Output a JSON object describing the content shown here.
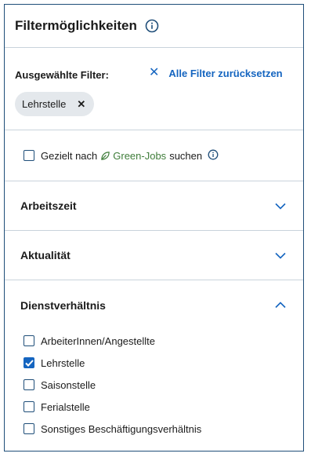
{
  "panel": {
    "title": "Filtermöglichkeiten",
    "selected_label": "Ausgewählte Filter:",
    "reset_label": "Alle Filter zurücksetzen",
    "chips": [
      "Lehrstelle"
    ],
    "green_jobs": {
      "prefix": "Gezielt nach",
      "link": "Green-Jobs",
      "suffix": "suchen",
      "checked": false
    },
    "sections": [
      {
        "title": "Arbeitszeit",
        "expanded": false
      },
      {
        "title": "Aktualität",
        "expanded": false
      },
      {
        "title": "Dienstverhältnis",
        "expanded": true
      }
    ],
    "options": [
      {
        "label": "ArbeiterInnen/Angestellte",
        "checked": false
      },
      {
        "label": "Lehrstelle",
        "checked": true
      },
      {
        "label": "Saisonstelle",
        "checked": false
      },
      {
        "label": "Ferialstelle",
        "checked": false
      },
      {
        "label": "Sonstiges Beschäftigungsverhältnis",
        "checked": false
      }
    ]
  },
  "colors": {
    "accent": "#1565c0",
    "border": "#1f4e79",
    "green": "#3f7d3a",
    "chip": "#e4e8ec"
  }
}
